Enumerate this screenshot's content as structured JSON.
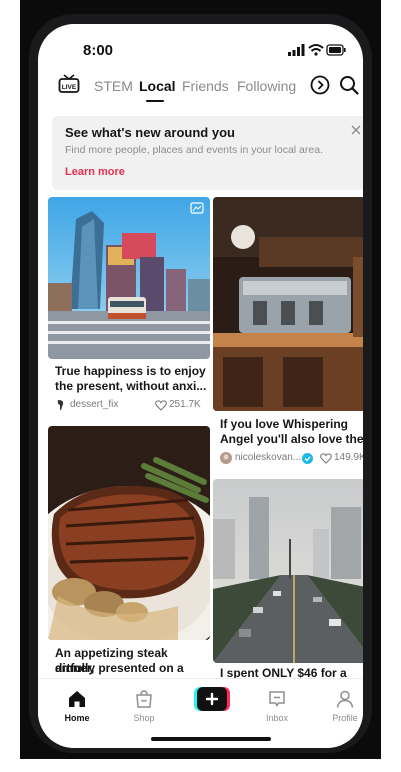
{
  "status_bar": {
    "time": "8:00"
  },
  "top_nav": {
    "tabs": [
      {
        "label": "STEM",
        "active": false
      },
      {
        "label": "Local",
        "active": true
      },
      {
        "label": "Friends",
        "active": false
      },
      {
        "label": "Following",
        "active": false
      }
    ]
  },
  "banner": {
    "title": "See what's new around you",
    "subtitle": "Find more people, places and events in your local area.",
    "link": "Learn more"
  },
  "feed": {
    "cards": [
      {
        "caption_line1": "True happiness is to enjoy",
        "caption_line2": "the present, without anxi...",
        "username": "dessert_fix",
        "likes": "251.7K"
      },
      {
        "caption_line1": "If you love Whispering",
        "caption_line2": "Angel you'll also love the...",
        "username": "nicoleskovan...",
        "likes": "149.9K"
      },
      {
        "caption_line1": "An appetizing steak dinner,",
        "caption_line2": "artfully presented on a wh..."
      },
      {
        "caption_line1": "I spent ONLY $46 for a"
      }
    ]
  },
  "bottom_nav": {
    "items": [
      {
        "label": "Home",
        "active": true
      },
      {
        "label": "Shop",
        "active": false
      },
      {
        "label": "Inbox",
        "active": false
      },
      {
        "label": "Profile",
        "active": false
      }
    ]
  },
  "colors": {
    "accent": "#e8304f",
    "text_primary": "#161616",
    "text_muted": "#8c8c8c"
  }
}
